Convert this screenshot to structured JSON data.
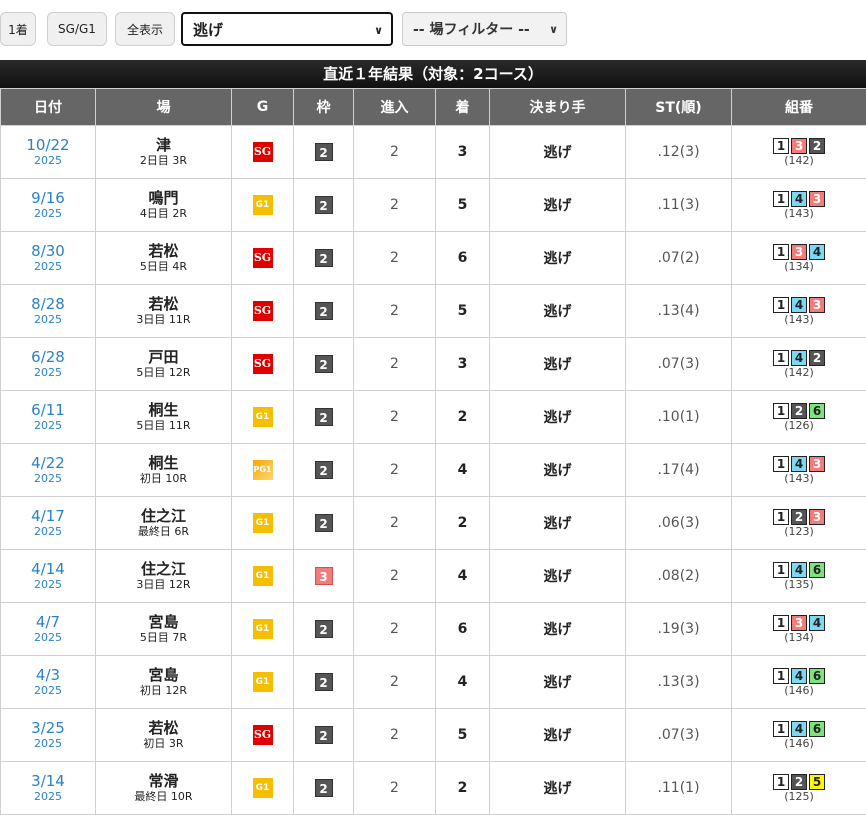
{
  "toolbar": {
    "btn_first": "1着",
    "btn_sg": "SG/G1",
    "btn_all": "全表示",
    "kimarite_select": "逃げ",
    "venue_select": "-- 場フィルター --"
  },
  "section_title": "直近１年結果（対象：2コース）",
  "headers": [
    "日付",
    "場",
    "G",
    "枠",
    "進入",
    "着",
    "決まり手",
    "ST(順)",
    "組番"
  ],
  "rows": [
    {
      "date": "10/22",
      "year": "2025",
      "venue": "津",
      "day": "2日目 3R",
      "grade": "SG",
      "waku": "2",
      "entry": "2",
      "rank": "3",
      "kimarite": "逃げ",
      "st": ".12(3)",
      "combo": [
        "1",
        "3",
        "2"
      ],
      "pop": "(142)"
    },
    {
      "date": "9/16",
      "year": "2025",
      "venue": "鳴門",
      "day": "4日目 2R",
      "grade": "G1",
      "waku": "2",
      "entry": "2",
      "rank": "5",
      "kimarite": "逃げ",
      "st": ".11(3)",
      "combo": [
        "1",
        "4",
        "3"
      ],
      "pop": "(143)"
    },
    {
      "date": "8/30",
      "year": "2025",
      "venue": "若松",
      "day": "5日目 4R",
      "grade": "SG",
      "waku": "2",
      "entry": "2",
      "rank": "6",
      "kimarite": "逃げ",
      "st": ".07(2)",
      "combo": [
        "1",
        "3",
        "4"
      ],
      "pop": "(134)"
    },
    {
      "date": "8/28",
      "year": "2025",
      "venue": "若松",
      "day": "3日目 11R",
      "grade": "SG",
      "waku": "2",
      "entry": "2",
      "rank": "5",
      "kimarite": "逃げ",
      "st": ".13(4)",
      "combo": [
        "1",
        "4",
        "3"
      ],
      "pop": "(143)"
    },
    {
      "date": "6/28",
      "year": "2025",
      "venue": "戸田",
      "day": "5日目 12R",
      "grade": "SG",
      "waku": "2",
      "entry": "2",
      "rank": "3",
      "kimarite": "逃げ",
      "st": ".07(3)",
      "combo": [
        "1",
        "4",
        "2"
      ],
      "pop": "(142)"
    },
    {
      "date": "6/11",
      "year": "2025",
      "venue": "桐生",
      "day": "5日目 11R",
      "grade": "G1",
      "waku": "2",
      "entry": "2",
      "rank": "2",
      "kimarite": "逃げ",
      "st": ".10(1)",
      "combo": [
        "1",
        "2",
        "6"
      ],
      "pop": "(126)"
    },
    {
      "date": "4/22",
      "year": "2025",
      "venue": "桐生",
      "day": "初日 10R",
      "grade": "PG1",
      "waku": "2",
      "entry": "2",
      "rank": "4",
      "kimarite": "逃げ",
      "st": ".17(4)",
      "combo": [
        "1",
        "4",
        "3"
      ],
      "pop": "(143)"
    },
    {
      "date": "4/17",
      "year": "2025",
      "venue": "住之江",
      "day": "最終日 6R",
      "grade": "G1",
      "waku": "2",
      "entry": "2",
      "rank": "2",
      "kimarite": "逃げ",
      "st": ".06(3)",
      "combo": [
        "1",
        "2",
        "3"
      ],
      "pop": "(123)"
    },
    {
      "date": "4/14",
      "year": "2025",
      "venue": "住之江",
      "day": "3日目 12R",
      "grade": "G1",
      "waku": "3",
      "entry": "2",
      "rank": "4",
      "kimarite": "逃げ",
      "st": ".08(2)",
      "combo": [
        "1",
        "4",
        "6"
      ],
      "pop": "(135)"
    },
    {
      "date": "4/7",
      "year": "2025",
      "venue": "宮島",
      "day": "5日目 7R",
      "grade": "G1",
      "waku": "2",
      "entry": "2",
      "rank": "6",
      "kimarite": "逃げ",
      "st": ".19(3)",
      "combo": [
        "1",
        "3",
        "4"
      ],
      "pop": "(134)"
    },
    {
      "date": "4/3",
      "year": "2025",
      "venue": "宮島",
      "day": "初日 12R",
      "grade": "G1",
      "waku": "2",
      "entry": "2",
      "rank": "4",
      "kimarite": "逃げ",
      "st": ".13(3)",
      "combo": [
        "1",
        "4",
        "6"
      ],
      "pop": "(146)"
    },
    {
      "date": "3/25",
      "year": "2025",
      "venue": "若松",
      "day": "初日 3R",
      "grade": "SG",
      "waku": "2",
      "entry": "2",
      "rank": "5",
      "kimarite": "逃げ",
      "st": ".07(3)",
      "combo": [
        "1",
        "4",
        "6"
      ],
      "pop": "(146)"
    },
    {
      "date": "3/14",
      "year": "2025",
      "venue": "常滑",
      "day": "最終日 10R",
      "grade": "G1",
      "waku": "2",
      "entry": "2",
      "rank": "2",
      "kimarite": "逃げ",
      "st": ".11(1)",
      "combo": [
        "1",
        "2",
        "5"
      ],
      "pop": "(125)"
    }
  ],
  "colors": {
    "header_bg": "#666666",
    "title_bg": "#111111",
    "date_link": "#2b82c8",
    "sg_badge": "#e00000",
    "g1_badge": "#f5bf00"
  }
}
